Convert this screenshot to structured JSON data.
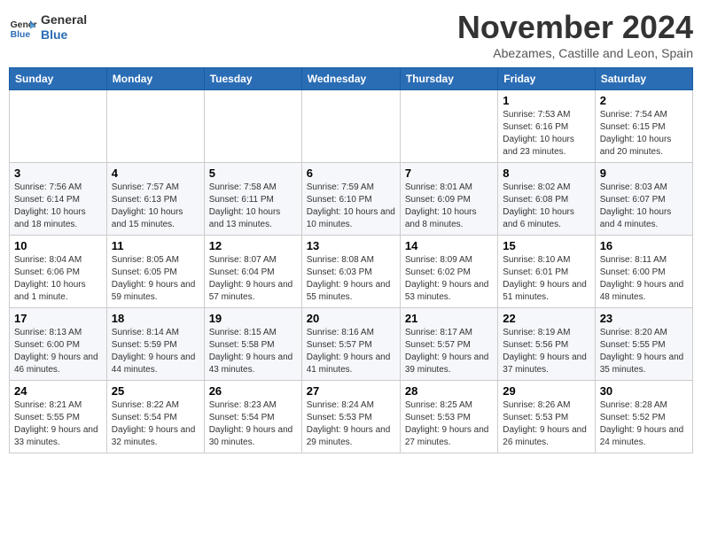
{
  "header": {
    "logo_line1": "General",
    "logo_line2": "Blue",
    "month_title": "November 2024",
    "subtitle": "Abezames, Castille and Leon, Spain"
  },
  "days_of_week": [
    "Sunday",
    "Monday",
    "Tuesday",
    "Wednesday",
    "Thursday",
    "Friday",
    "Saturday"
  ],
  "weeks": [
    [
      {
        "day": "",
        "info": ""
      },
      {
        "day": "",
        "info": ""
      },
      {
        "day": "",
        "info": ""
      },
      {
        "day": "",
        "info": ""
      },
      {
        "day": "",
        "info": ""
      },
      {
        "day": "1",
        "info": "Sunrise: 7:53 AM\nSunset: 6:16 PM\nDaylight: 10 hours and 23 minutes."
      },
      {
        "day": "2",
        "info": "Sunrise: 7:54 AM\nSunset: 6:15 PM\nDaylight: 10 hours and 20 minutes."
      }
    ],
    [
      {
        "day": "3",
        "info": "Sunrise: 7:56 AM\nSunset: 6:14 PM\nDaylight: 10 hours and 18 minutes."
      },
      {
        "day": "4",
        "info": "Sunrise: 7:57 AM\nSunset: 6:13 PM\nDaylight: 10 hours and 15 minutes."
      },
      {
        "day": "5",
        "info": "Sunrise: 7:58 AM\nSunset: 6:11 PM\nDaylight: 10 hours and 13 minutes."
      },
      {
        "day": "6",
        "info": "Sunrise: 7:59 AM\nSunset: 6:10 PM\nDaylight: 10 hours and 10 minutes."
      },
      {
        "day": "7",
        "info": "Sunrise: 8:01 AM\nSunset: 6:09 PM\nDaylight: 10 hours and 8 minutes."
      },
      {
        "day": "8",
        "info": "Sunrise: 8:02 AM\nSunset: 6:08 PM\nDaylight: 10 hours and 6 minutes."
      },
      {
        "day": "9",
        "info": "Sunrise: 8:03 AM\nSunset: 6:07 PM\nDaylight: 10 hours and 4 minutes."
      }
    ],
    [
      {
        "day": "10",
        "info": "Sunrise: 8:04 AM\nSunset: 6:06 PM\nDaylight: 10 hours and 1 minute."
      },
      {
        "day": "11",
        "info": "Sunrise: 8:05 AM\nSunset: 6:05 PM\nDaylight: 9 hours and 59 minutes."
      },
      {
        "day": "12",
        "info": "Sunrise: 8:07 AM\nSunset: 6:04 PM\nDaylight: 9 hours and 57 minutes."
      },
      {
        "day": "13",
        "info": "Sunrise: 8:08 AM\nSunset: 6:03 PM\nDaylight: 9 hours and 55 minutes."
      },
      {
        "day": "14",
        "info": "Sunrise: 8:09 AM\nSunset: 6:02 PM\nDaylight: 9 hours and 53 minutes."
      },
      {
        "day": "15",
        "info": "Sunrise: 8:10 AM\nSunset: 6:01 PM\nDaylight: 9 hours and 51 minutes."
      },
      {
        "day": "16",
        "info": "Sunrise: 8:11 AM\nSunset: 6:00 PM\nDaylight: 9 hours and 48 minutes."
      }
    ],
    [
      {
        "day": "17",
        "info": "Sunrise: 8:13 AM\nSunset: 6:00 PM\nDaylight: 9 hours and 46 minutes."
      },
      {
        "day": "18",
        "info": "Sunrise: 8:14 AM\nSunset: 5:59 PM\nDaylight: 9 hours and 44 minutes."
      },
      {
        "day": "19",
        "info": "Sunrise: 8:15 AM\nSunset: 5:58 PM\nDaylight: 9 hours and 43 minutes."
      },
      {
        "day": "20",
        "info": "Sunrise: 8:16 AM\nSunset: 5:57 PM\nDaylight: 9 hours and 41 minutes."
      },
      {
        "day": "21",
        "info": "Sunrise: 8:17 AM\nSunset: 5:57 PM\nDaylight: 9 hours and 39 minutes."
      },
      {
        "day": "22",
        "info": "Sunrise: 8:19 AM\nSunset: 5:56 PM\nDaylight: 9 hours and 37 minutes."
      },
      {
        "day": "23",
        "info": "Sunrise: 8:20 AM\nSunset: 5:55 PM\nDaylight: 9 hours and 35 minutes."
      }
    ],
    [
      {
        "day": "24",
        "info": "Sunrise: 8:21 AM\nSunset: 5:55 PM\nDaylight: 9 hours and 33 minutes."
      },
      {
        "day": "25",
        "info": "Sunrise: 8:22 AM\nSunset: 5:54 PM\nDaylight: 9 hours and 32 minutes."
      },
      {
        "day": "26",
        "info": "Sunrise: 8:23 AM\nSunset: 5:54 PM\nDaylight: 9 hours and 30 minutes."
      },
      {
        "day": "27",
        "info": "Sunrise: 8:24 AM\nSunset: 5:53 PM\nDaylight: 9 hours and 29 minutes."
      },
      {
        "day": "28",
        "info": "Sunrise: 8:25 AM\nSunset: 5:53 PM\nDaylight: 9 hours and 27 minutes."
      },
      {
        "day": "29",
        "info": "Sunrise: 8:26 AM\nSunset: 5:53 PM\nDaylight: 9 hours and 26 minutes."
      },
      {
        "day": "30",
        "info": "Sunrise: 8:28 AM\nSunset: 5:52 PM\nDaylight: 9 hours and 24 minutes."
      }
    ]
  ]
}
